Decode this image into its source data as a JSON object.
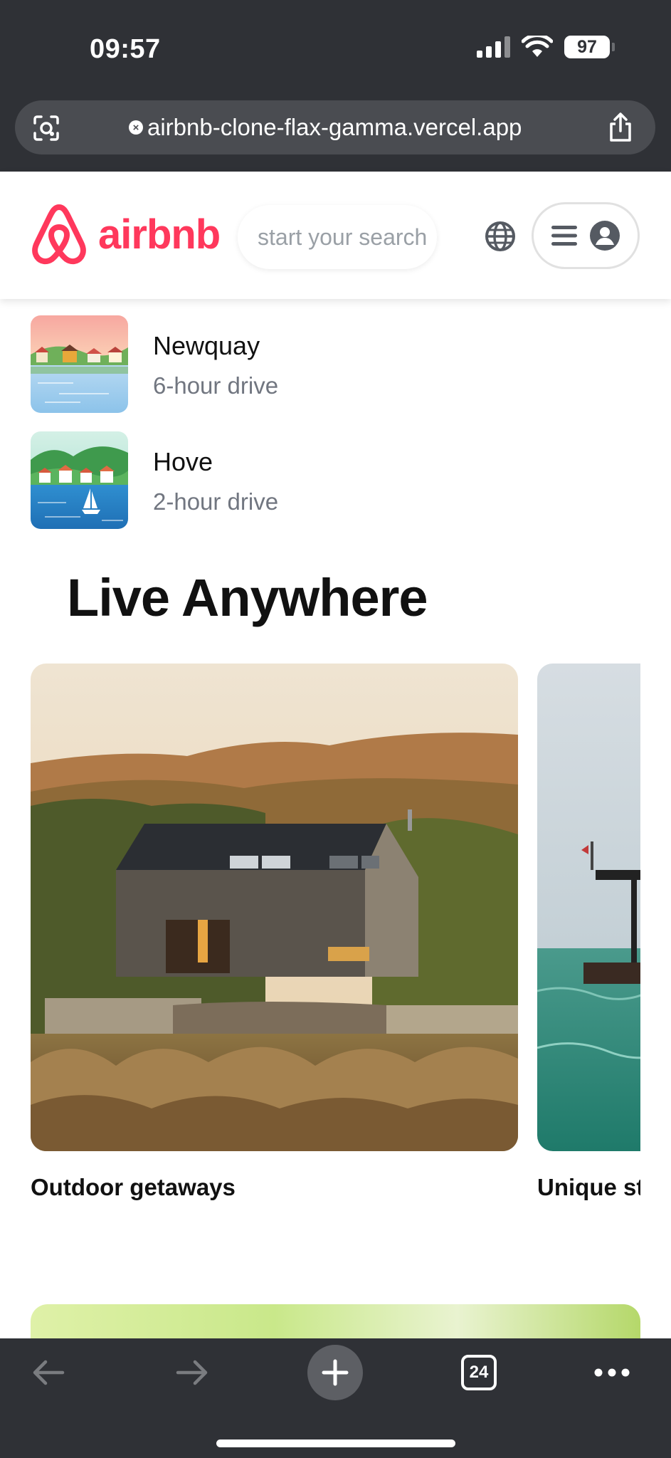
{
  "status_bar": {
    "time": "09:57",
    "battery": "97"
  },
  "browser": {
    "url": "airbnb-clone-flax-gamma.vercel.app",
    "tabs_count": "24",
    "icons": [
      "lens-icon",
      "clear-icon",
      "share-icon",
      "back-icon",
      "forward-icon",
      "new-tab-icon",
      "tabs-icon",
      "more-icon"
    ]
  },
  "header": {
    "logo_text": "airbnb",
    "search_placeholder": "start your search",
    "brand_color": "#ff385c"
  },
  "nearby": [
    {
      "name": "Newquay",
      "distance": "6-hour drive"
    },
    {
      "name": "Hove",
      "distance": "2-hour drive"
    }
  ],
  "live_anywhere": {
    "title": "Live Anywhere",
    "cards": [
      {
        "title": "Outdoor getaways"
      },
      {
        "title": "Unique stays"
      }
    ]
  }
}
